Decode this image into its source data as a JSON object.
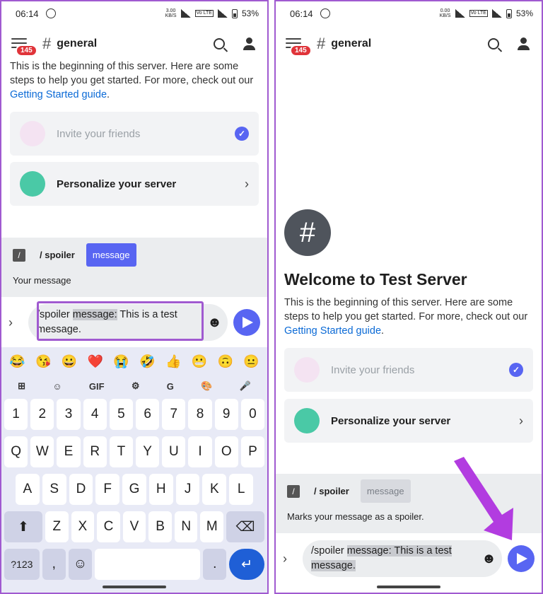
{
  "status": {
    "time": "06:14",
    "left_speed": "3.00\nKB/S",
    "right_speed": "0.00\nKB/S",
    "volte": "Vo LTE",
    "battery": "53%"
  },
  "header": {
    "badge": "145",
    "hash": "#",
    "channel": "general"
  },
  "intro": {
    "text": "This is the beginning of this server. Here are some steps to help you get started. For more, check out our ",
    "link": "Getting Started guide",
    "end": "."
  },
  "welcome": {
    "server_glyph": "#",
    "title": "Welcome to Test Server"
  },
  "cards": {
    "invite": "Invite your friends",
    "personalize": "Personalize your server",
    "check": "✓",
    "chevron": "›"
  },
  "command": {
    "name": "/ spoiler",
    "option": "message",
    "desc_left": "Your message",
    "desc_right": "Marks your message as a spoiler."
  },
  "composer": {
    "expand": "›",
    "prefix": "/spoiler ",
    "option": "message:",
    "value": " This is a test message.",
    "right_text": " This is a test message.",
    "emoji": "☻"
  },
  "keyboard": {
    "emojis": [
      "😂",
      "😘",
      "😀",
      "❤️",
      "😭",
      "🤣",
      "👍",
      "😬",
      "🙃",
      "😐"
    ],
    "tools": [
      "⊞",
      "☺",
      "GIF",
      "⚙",
      "G",
      "🎨",
      "🎤"
    ],
    "numbers": [
      "1",
      "2",
      "3",
      "4",
      "5",
      "6",
      "7",
      "8",
      "9",
      "0"
    ],
    "row1": [
      "Q",
      "W",
      "E",
      "R",
      "T",
      "Y",
      "U",
      "I",
      "O",
      "P"
    ],
    "row2": [
      "A",
      "S",
      "D",
      "F",
      "G",
      "H",
      "J",
      "K",
      "L"
    ],
    "row3": [
      "Z",
      "X",
      "C",
      "V",
      "B",
      "N",
      "M"
    ],
    "shift": "⬆",
    "backspace": "⌫",
    "sym": "?123",
    "comma": ",",
    "emoji_key": "☺",
    "period": ".",
    "enter": "↵"
  }
}
